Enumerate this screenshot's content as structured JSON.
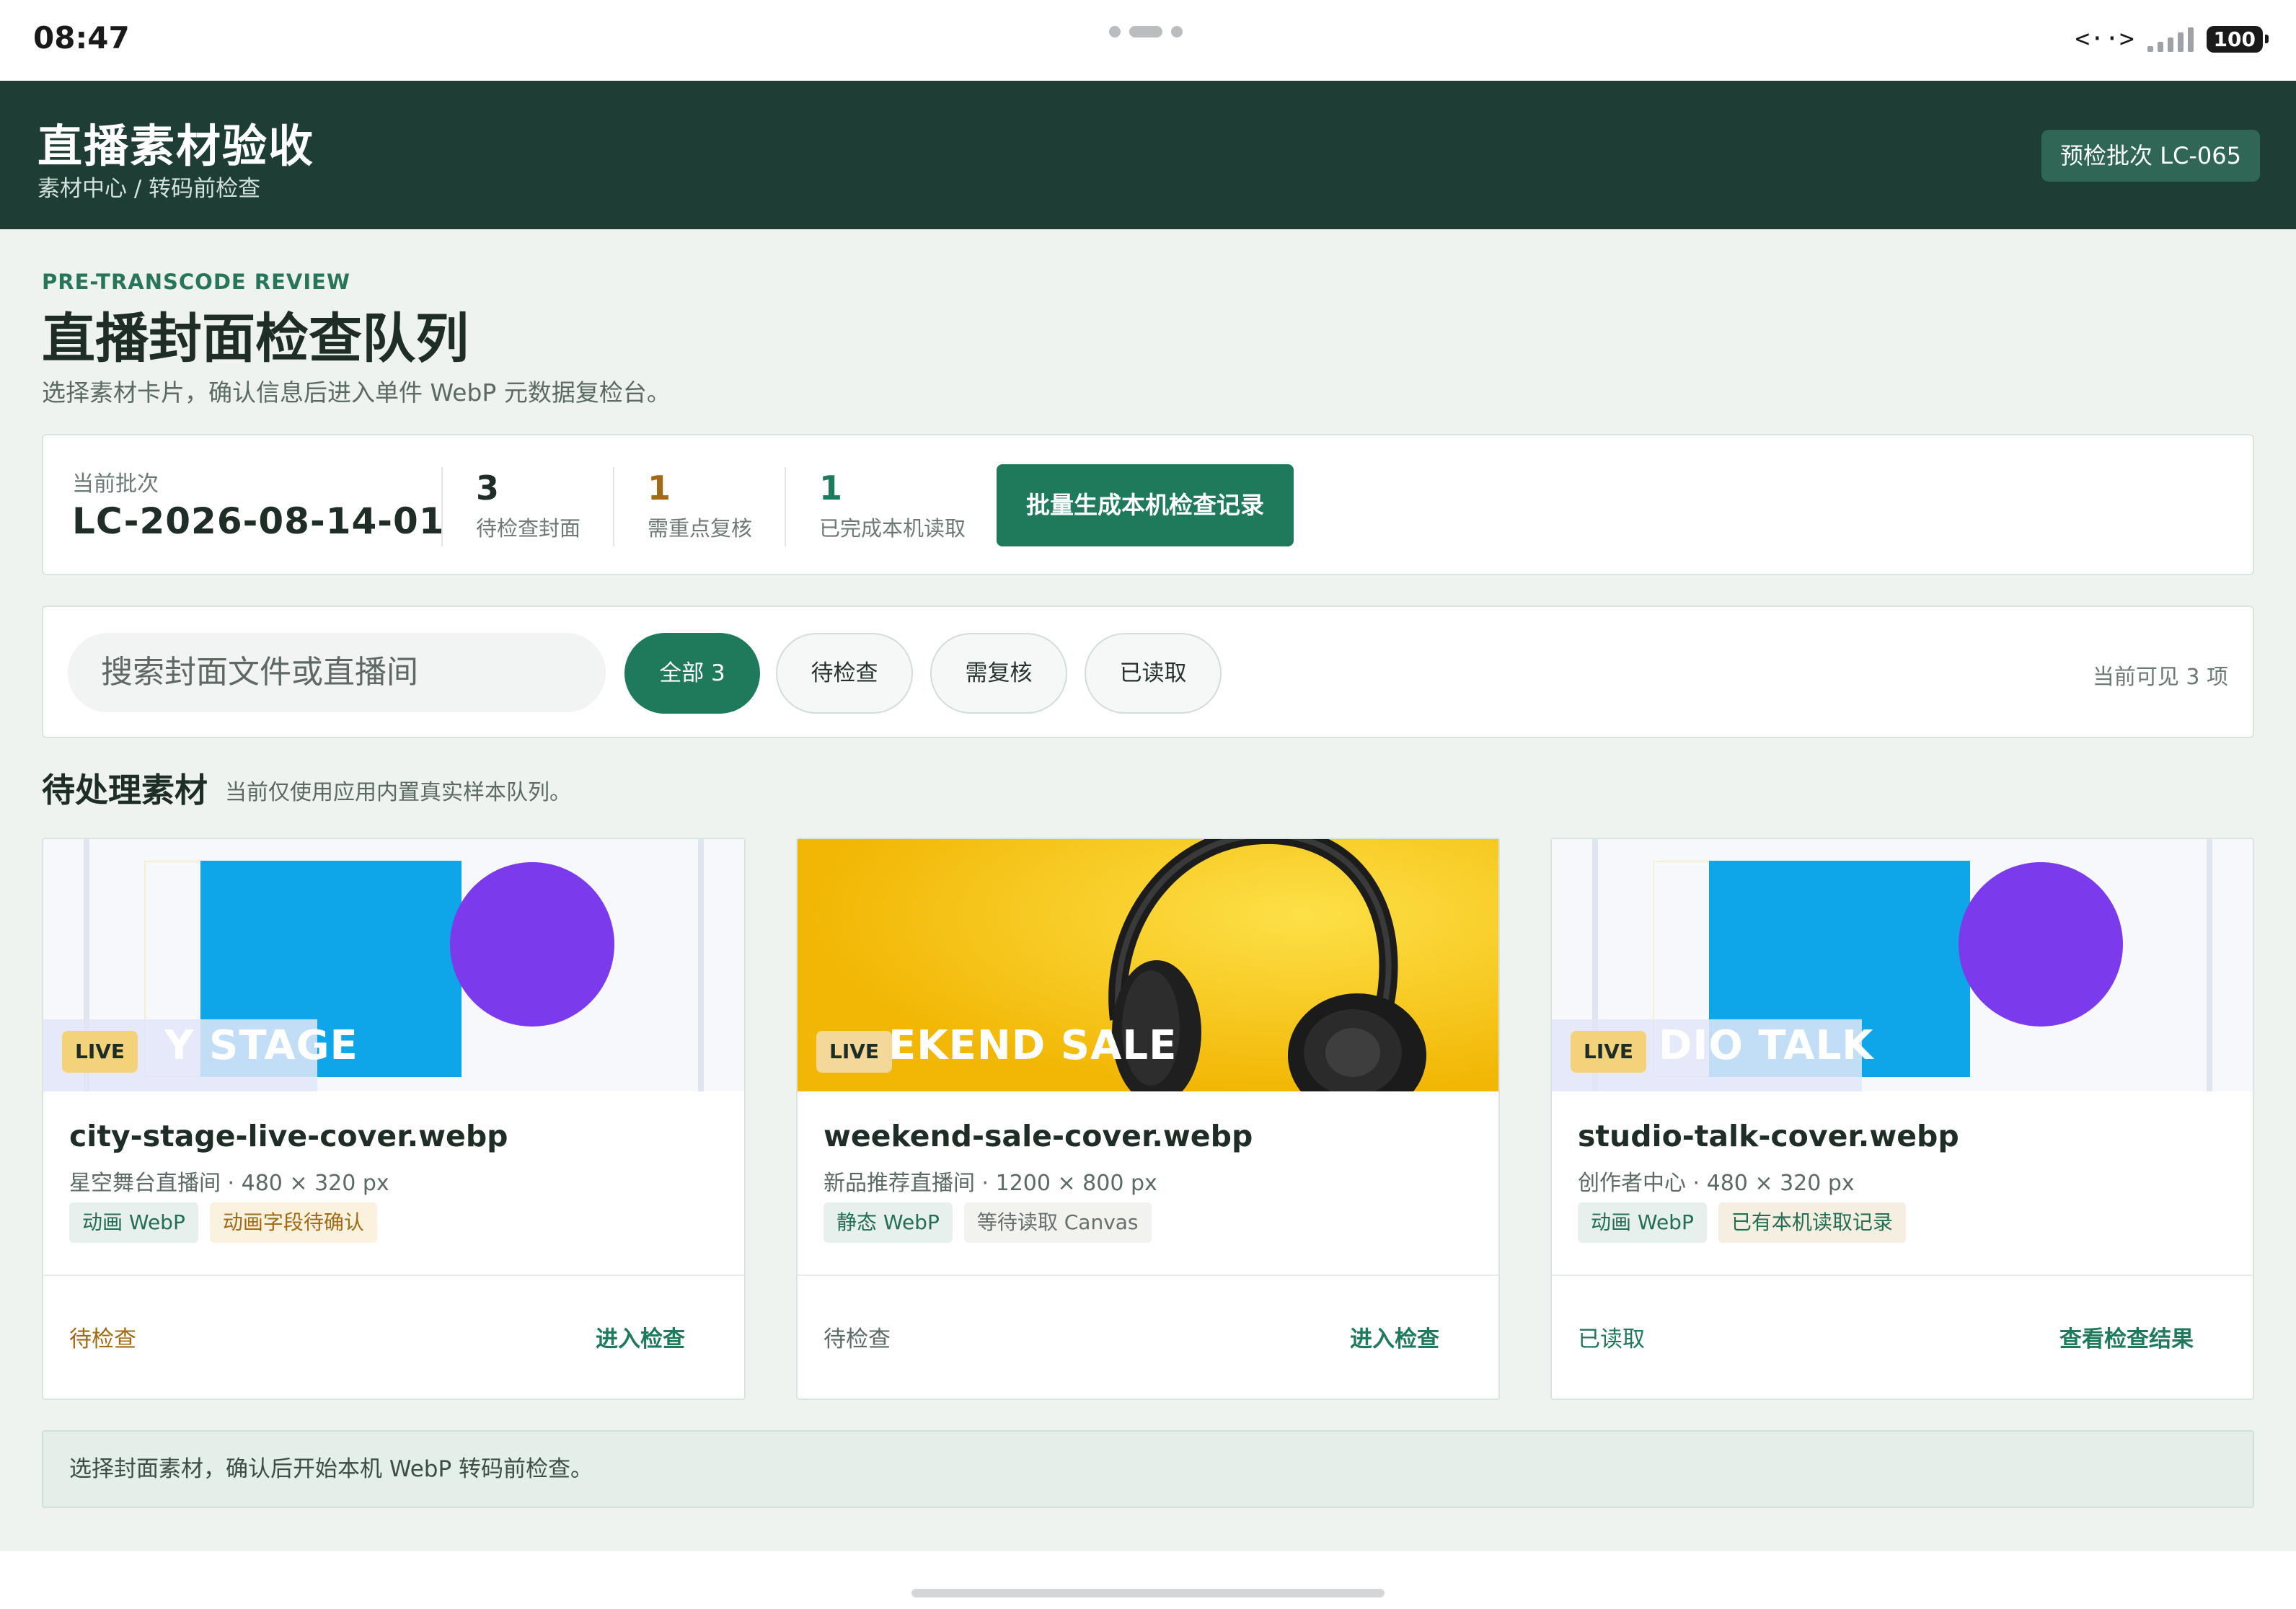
{
  "status": {
    "time": "08:47",
    "network": "<··>",
    "battery": "100"
  },
  "header": {
    "title": "直播素材验收",
    "breadcrumb": "素材中心 / 转码前检查",
    "batch_pill": "预检批次 LC-065"
  },
  "intro": {
    "eyebrow": "PRE-TRANSCODE REVIEW",
    "title": "直播封面检查队列",
    "subtitle": "选择素材卡片，确认信息后进入单件 WebP 元数据复检台。"
  },
  "summary": {
    "batch_label": "当前批次",
    "batch_value": "LC-2026-08-14-01",
    "stats": [
      {
        "value": "3",
        "label": "待检查封面",
        "color": "#1e2e27"
      },
      {
        "value": "1",
        "label": "需重点复核",
        "color": "#a16a14"
      },
      {
        "value": "1",
        "label": "已完成本机读取",
        "color": "#1f7a5c"
      }
    ],
    "primary_button": "批量生成本机检查记录"
  },
  "filters": {
    "search_placeholder": "搜索封面文件或直播间",
    "chips": [
      {
        "label": "全部 3",
        "active": true
      },
      {
        "label": "待检查",
        "active": false
      },
      {
        "label": "需复核",
        "active": false
      },
      {
        "label": "已读取",
        "active": false
      }
    ],
    "visible_count": "当前可见 3 项"
  },
  "section": {
    "title": "待处理素材",
    "note": "当前仅使用应用内置真实样本队列。"
  },
  "cards": [
    {
      "live_badge": "LIVE",
      "overlay_text": "Y STAGE",
      "filename": "city-stage-live-cover.webp",
      "meta": "星空舞台直播间 · 480 × 320 px",
      "tags": [
        "动画 WebP",
        "动画字段待确认"
      ],
      "status": "待检查",
      "status_color": "#a16a14",
      "action": "进入检查"
    },
    {
      "live_badge": "LIVE",
      "overlay_text": "EKEND SALE",
      "filename": "weekend-sale-cover.webp",
      "meta": "新品推荐直播间 · 1200 × 800 px",
      "tags": [
        "静态 WebP",
        "等待读取 Canvas"
      ],
      "status": "待检查",
      "status_color": "#5b6b64",
      "action": "进入检查"
    },
    {
      "live_badge": "LIVE",
      "overlay_text": "DIO TALK",
      "filename": "studio-talk-cover.webp",
      "meta": "创作者中心 · 480 × 320 px",
      "tags": [
        "动画 WebP",
        "已有本机读取记录"
      ],
      "status": "已读取",
      "status_color": "#1f7a5c",
      "action": "查看检查结果"
    }
  ],
  "notice": "选择封面素材，确认后开始本机 WebP 转码前检查。",
  "colors": {
    "header_bg": "#1d3d35",
    "accent": "#1f7a5c",
    "warning": "#a16a14",
    "page_bg": "#eef3f0"
  }
}
